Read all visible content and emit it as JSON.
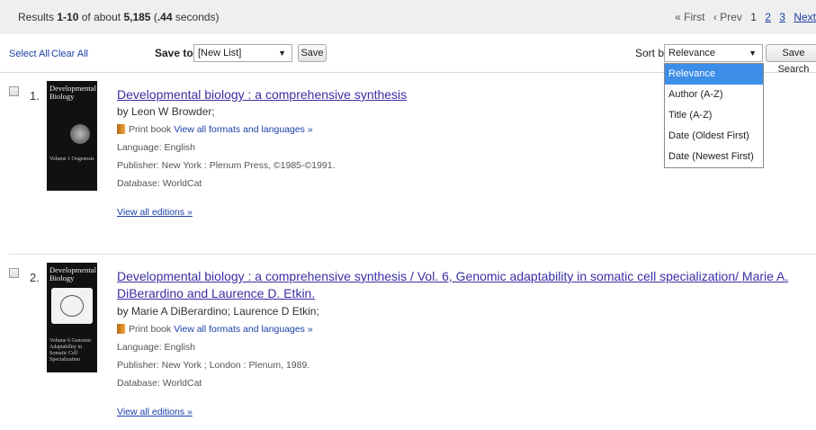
{
  "summary": {
    "prefix": "Results",
    "range": "1-10",
    "of_about": "of about",
    "total": "5,185",
    "time_open": "(",
    "time": ".44",
    "time_close": "seconds)"
  },
  "pager": {
    "first": "« First",
    "prev": "‹ Prev",
    "current": "1",
    "pages": [
      "2",
      "3"
    ],
    "next": "Next"
  },
  "toolbar": {
    "select_all": "Select All",
    "clear_all": "Clear All",
    "save_to_label": "Save to:",
    "save_list_value": "[New List]",
    "save_button": "Save",
    "sort_label": "Sort by:",
    "sort_value": "Relevance",
    "save_search_button": "Save Search"
  },
  "sort_options": [
    "Relevance",
    "Author (A-Z)",
    "Title (A-Z)",
    "Date (Oldest First)",
    "Date (Newest First)"
  ],
  "results": [
    {
      "number": "1.",
      "cover_title": "Developmental Biology",
      "cover_volume": "Volume 1 Oogenesis",
      "title": "Developmental biology : a comprehensive synthesis",
      "author": "by Leon W Browder;",
      "format": "Print book",
      "formats_link": "View all formats and languages »",
      "language": "Language: English",
      "publisher": "Publisher: New York : Plenum Press, ©1985-©1991.",
      "database": "Database: WorldCat",
      "editions_link": "View all editions »"
    },
    {
      "number": "2.",
      "cover_title": "Developmental Biology",
      "cover_volume": "Volume 6 Genomic Adaptability in Somatic Cell Specialization",
      "title": "Developmental biology : a comprehensive synthesis / Vol. 6, Genomic adaptability in somatic cell specialization/ Marie A. DiBerardino and Laurence D. Etkin.",
      "author": "by Marie A DiBerardino; Laurence D Etkin;",
      "format": "Print book",
      "formats_link": "View all formats and languages »",
      "language": "Language: English",
      "publisher": "Publisher: New York ; London : Plenum, 1989.",
      "database": "Database: WorldCat",
      "editions_link": "View all editions »"
    }
  ],
  "colors": {
    "title_link": "#3a2fa3",
    "link": "#1a3fa8",
    "dropdown_highlight": "#3c8ee8",
    "top_bar": "#efefef"
  }
}
